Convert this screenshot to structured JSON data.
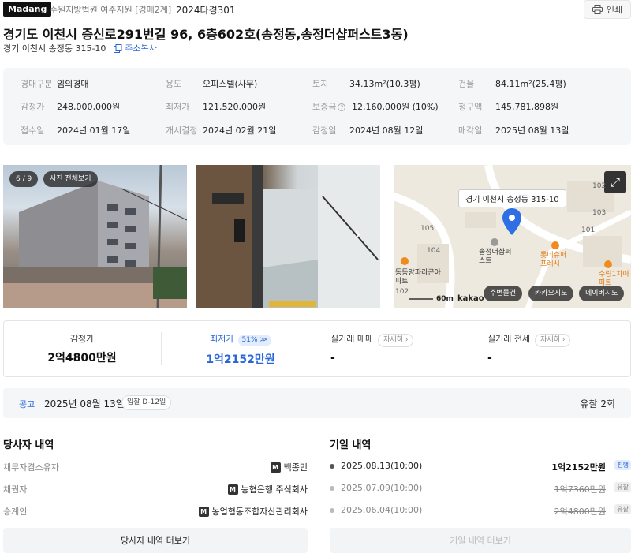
{
  "header": {
    "logo": "Madang",
    "court": "수원지방법원 여주지원 [경매2계]",
    "case_no": "2024타경301",
    "print_label": "인쇄"
  },
  "property": {
    "title": "경기도 이천시 증신로291번길 96, 6층602호(송정동,송정더샵퍼스트3동)",
    "lot_address": "경기 이천시 송정동 315-10",
    "copy_label": "주소복사"
  },
  "info": {
    "auction_type": {
      "label": "경매구분",
      "value": "임의경매"
    },
    "usage": {
      "label": "용도",
      "value": "오피스텔(사무)"
    },
    "land": {
      "label": "토지",
      "value": "34.13m²(10.3평)"
    },
    "building": {
      "label": "건물",
      "value": "84.11m²(25.4평)"
    },
    "appraisal": {
      "label": "감정가",
      "value": "248,000,000원"
    },
    "min_price": {
      "label": "최저가",
      "value": "121,520,000원"
    },
    "deposit": {
      "label": "보증금",
      "value": "12,160,000원 (10%)"
    },
    "claim": {
      "label": "청구액",
      "value": "145,781,898원"
    },
    "received": {
      "label": "접수일",
      "value": "2024년 01월 17일"
    },
    "start_decision": {
      "label": "개시결정",
      "value": "2024년 02월 21일"
    },
    "appraisal_date": {
      "label": "감정일",
      "value": "2024년 08월 12일"
    },
    "sale_date": {
      "label": "매각일",
      "value": "2025년 08월 13일"
    }
  },
  "gallery": {
    "counter": "6 / 9",
    "view_all": "사진 전체보기"
  },
  "map": {
    "address_tooltip": "경기 이천시 송정동 315-10",
    "places": [
      "송정더샵퍼스트",
      "롯데슈퍼프레시",
      "동동양파라곤아파트",
      "수림1차아파트"
    ],
    "block_numbers": [
      "105",
      "104",
      "103",
      "102",
      "101",
      "102"
    ],
    "scale": "60m",
    "provider": "kakao",
    "buttons": [
      "주변물건",
      "카카오지도",
      "네이버지도"
    ]
  },
  "prices": {
    "appraisal": {
      "label": "감정가",
      "value": "2억4800만원"
    },
    "minimum": {
      "label": "최저가",
      "value": "1억2152만원",
      "percent": "51%"
    },
    "sale_trade": {
      "label": "실거래 매매",
      "detail": "자세히",
      "value": "-"
    },
    "jeonse_trade": {
      "label": "실거래 전세",
      "detail": "자세히",
      "value": "-"
    }
  },
  "notice": {
    "label": "공고",
    "date": "2025년 08월 13일",
    "dday": "입찰 D-12일",
    "fail_count": "유찰 2회"
  },
  "parties": {
    "title": "당사자 내역",
    "rows": [
      {
        "role": "채무자겸소유자",
        "name": "백종민"
      },
      {
        "role": "채권자",
        "name": "농협은행 주식회사"
      },
      {
        "role": "승계인",
        "name": "농업협동조합자산관리회사"
      }
    ],
    "more": "당사자 내역 더보기"
  },
  "history": {
    "title": "기일 내역",
    "rows": [
      {
        "date": "2025.08.13(10:00)",
        "price": "1억2152만원",
        "status": "진행"
      },
      {
        "date": "2025.07.09(10:00)",
        "price": "1억7360만원",
        "status": "유찰"
      },
      {
        "date": "2025.06.04(10:00)",
        "price": "2억4800만원",
        "status": "유찰"
      }
    ],
    "more": "기일 내역 더보기"
  },
  "colors": {
    "accent": "#2a67d8",
    "map_pin": "#2f6fe4",
    "poi_orange": "#f28b1e"
  }
}
